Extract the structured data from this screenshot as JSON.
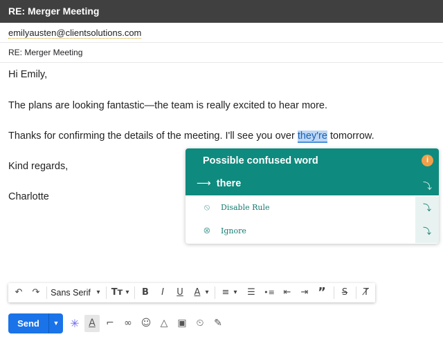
{
  "window": {
    "title": "RE: Merger Meeting"
  },
  "compose": {
    "to": "emilyausten@clientsolutions.com",
    "subject": "RE: Merger Meeting",
    "body": {
      "greeting": "Hi Emily,",
      "p1": "The plans are looking fantastic—the team is really excited to hear more.",
      "p2_before": "Thanks for confirming the details of the meeting. I'll see you over ",
      "p2_highlight": "they're",
      "p2_after": " tomorrow.",
      "closing": "Kind regards,",
      "signature": "Charlotte"
    }
  },
  "grammarly": {
    "title": "Possible confused word",
    "info_glyph": "i",
    "arrow_glyph": "⟶",
    "suggestion": "there",
    "apply_glyph": "⤵",
    "actions": [
      {
        "label": "Disable Rule",
        "icon": "eye-slash-icon",
        "glyph": "⦸"
      },
      {
        "label": "Ignore",
        "icon": "circle-x-icon",
        "glyph": "⊗"
      }
    ],
    "colors": {
      "header": "#0f8a7e",
      "info": "#f0a04b",
      "highlight": "#bcd7f5"
    }
  },
  "toolbar": {
    "undo": "↶",
    "redo": "↷",
    "font": "Sans Serif",
    "caret": "▾",
    "size": "Τт",
    "bold": "B",
    "italic": "I",
    "underline": "U",
    "textcolor": "A",
    "align": "≡",
    "numbered": "☰",
    "bulleted": "•≡",
    "indent_less": "⇤",
    "indent_more": "⇥",
    "quote": "”",
    "strike": "S",
    "clear": "T̸"
  },
  "bottom_bar": {
    "send_label": "Send",
    "send_dropdown": "▼",
    "grammarly_icon": "✳",
    "formatting": "A",
    "attach": "⌐",
    "link": "∞",
    "emoji": "☺",
    "drive": "△",
    "photo": "▣",
    "confidential": "⏲",
    "signature": "✎"
  }
}
